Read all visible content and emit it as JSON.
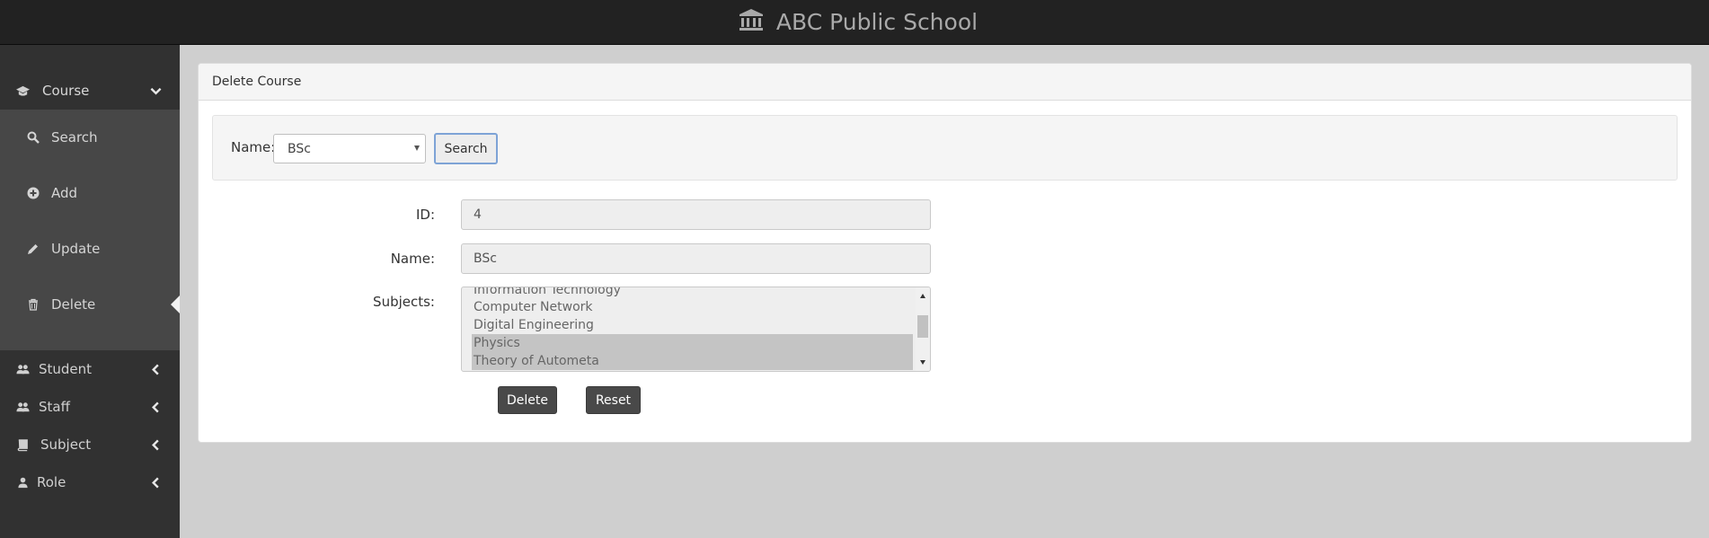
{
  "header": {
    "title": "ABC Public School",
    "logo_icon": "institution-icon"
  },
  "sidebar": {
    "course": {
      "label": "Course",
      "icon": "graduation-cap-icon"
    },
    "course_items": [
      {
        "label": "Search",
        "icon": "search-icon"
      },
      {
        "label": "Add",
        "icon": "plus-circle-icon"
      },
      {
        "label": "Update",
        "icon": "pencil-icon"
      },
      {
        "label": "Delete",
        "icon": "trash-icon",
        "active": true
      }
    ],
    "sections": [
      {
        "label": "Student",
        "icon": "users-icon"
      },
      {
        "label": "Staff",
        "icon": "users-icon"
      },
      {
        "label": "Subject",
        "icon": "book-icon"
      },
      {
        "label": "Role",
        "icon": "user-icon"
      }
    ]
  },
  "panel": {
    "title": "Delete Course",
    "search": {
      "label": "Name:",
      "selected": "BSc",
      "button": "Search"
    },
    "form": {
      "id_label": "ID:",
      "id_value": "4",
      "name_label": "Name:",
      "name_value": "BSc",
      "subjects_label": "Subjects:",
      "subjects": [
        {
          "name": "Information Technology",
          "selected": false
        },
        {
          "name": "Computer Network",
          "selected": false
        },
        {
          "name": "Digital Engineering",
          "selected": false
        },
        {
          "name": "Physics",
          "selected": true
        },
        {
          "name": "Theory of Autometa",
          "selected": true
        }
      ]
    },
    "buttons": {
      "delete": "Delete",
      "reset": "Reset"
    }
  },
  "colors": {
    "topbar": "#222222",
    "sidebar": "#313131",
    "submenu": "#474747",
    "button": "#494949",
    "focus_border": "#7ea3d6"
  }
}
